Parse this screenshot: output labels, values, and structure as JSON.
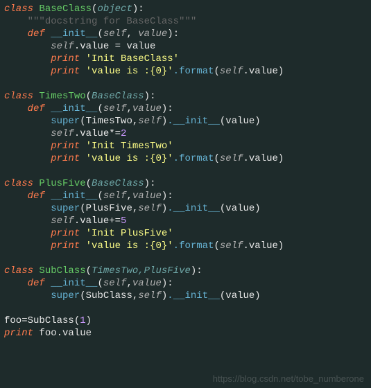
{
  "kw": {
    "class": "class",
    "def": "def",
    "print": "print"
  },
  "builtin_object": "object",
  "class1": {
    "name": "BaseClass",
    "docstring": "\"\"\"docstring for BaseClass\"\"\"",
    "init_name": "__init__",
    "self": "self",
    "param": "value",
    "assign_attr": ".value = value",
    "print1": "'Init BaseClass'",
    "print2_a": "'value is :{0}'",
    "format_fn": ".format",
    "attr_value": ".value"
  },
  "class2": {
    "name": "TimesTwo",
    "base": "BaseClass",
    "init_name": "__init__",
    "self": "self",
    "param": "value",
    "super_fn": "super",
    "dot_init": ".__init__",
    "call_args_prefix": "(TimesTwo,",
    "call_args_suffix": ")",
    "init_call_args": "(value)",
    "mutate_attr": ".value*=",
    "mutate_num": "2",
    "print1": "'Init TimesTwo'",
    "print2_a": "'value is :{0}'",
    "format_fn": ".format",
    "attr_value": ".value"
  },
  "class3": {
    "name": "PlusFive",
    "base": "BaseClass",
    "init_name": "__init__",
    "self": "self",
    "param": "value",
    "super_fn": "super",
    "dot_init": ".__init__",
    "call_args_prefix": "(PlusFive,",
    "call_args_suffix": ")",
    "init_call_args": "(value)",
    "mutate_attr": ".value+=",
    "mutate_num": "5",
    "print1": "'Init PlusFive'",
    "print2_a": "'value is :{0}'",
    "format_fn": ".format",
    "attr_value": ".value"
  },
  "class4": {
    "name": "SubClass",
    "bases": "TimesTwo,PlusFive",
    "init_name": "__init__",
    "self": "self",
    "param": "value",
    "super_fn": "super",
    "dot_init": ".__init__",
    "call_args_prefix": "(SubClass,",
    "call_args_suffix": ")",
    "init_call_args": "(value)"
  },
  "footer": {
    "var": "foo",
    "eq": "=",
    "ctor": "SubClass",
    "arg_num": "1",
    "print_kw": "print",
    "print_expr": "foo.value"
  },
  "watermark": "https://blog.csdn.net/tobe_numberone"
}
